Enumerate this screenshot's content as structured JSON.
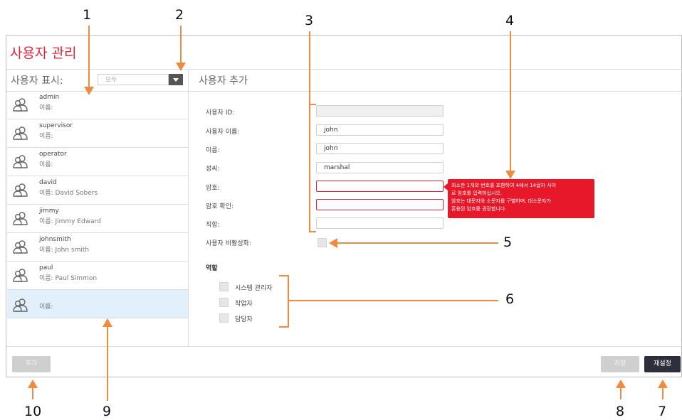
{
  "window": {
    "title": "사용자 관리"
  },
  "sidebar": {
    "filter_label": "사용자 표시:",
    "filter_value": "모두",
    "name_prefix": "이름:",
    "users": [
      {
        "id": "admin",
        "full_name": ""
      },
      {
        "id": "supervisor",
        "full_name": ""
      },
      {
        "id": "operator",
        "full_name": ""
      },
      {
        "id": "david",
        "full_name": "David Sobers"
      },
      {
        "id": "jimmy",
        "full_name": "Jimmy Edward"
      },
      {
        "id": "johnsmith",
        "full_name": "John smith"
      },
      {
        "id": "paul",
        "full_name": "Paul Simmon"
      },
      {
        "id": "",
        "full_name": "",
        "selected": true
      }
    ]
  },
  "form": {
    "section_title": "사용자 추가",
    "fields": [
      {
        "label": "사용자 ID:",
        "value": ""
      },
      {
        "label": "사용자 이름:",
        "value": "john"
      },
      {
        "label": "이름:",
        "value": "john"
      },
      {
        "label": "성씨:",
        "value": "marshal"
      },
      {
        "label": "암호:",
        "value": ""
      },
      {
        "label": "암호 확인:",
        "value": ""
      },
      {
        "label": "직함:",
        "value": ""
      }
    ],
    "disable_label": "사용자 비활성화:",
    "password_tooltip": [
      "최소한 1개의 번호를 포함하여 4에서 14글자 사이",
      "로 암호를 입력하십시오.",
      "암호는 대문자와 소문자를 구별하며, 대소문자가",
      "혼용된 암호를 권장합니다."
    ],
    "roles_heading": "역할",
    "roles": [
      "시스템 관리자",
      "작업자",
      "담당자"
    ]
  },
  "buttons": {
    "add": "추가",
    "save": "저장",
    "reset": "재설정"
  },
  "callouts": [
    "1",
    "2",
    "3",
    "4",
    "5",
    "6",
    "7",
    "8",
    "9",
    "10"
  ],
  "colors": {
    "title": "#e0253a",
    "error": "#e8182b",
    "callout": "#f08a3e",
    "selected_row": "#e1f0fb",
    "dark_button": "#2f2f3b"
  }
}
